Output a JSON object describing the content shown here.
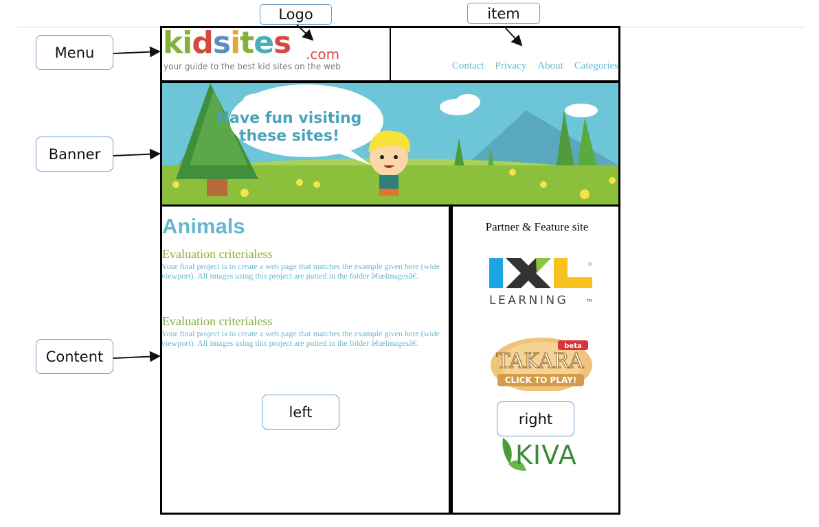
{
  "annotations": {
    "logo": "Logo",
    "item": "item",
    "menu": "Menu",
    "banner": "Banner",
    "content": "Content",
    "left": "left",
    "right": "right"
  },
  "logo": {
    "letters": [
      "k",
      "i",
      "d",
      "s",
      "i",
      "t",
      "e",
      "s"
    ],
    "domain_suffix": ".com",
    "tagline": "your guide to the best kid sites on the web"
  },
  "nav": {
    "items": [
      "Contact",
      "Privacy",
      "About",
      "Categories"
    ]
  },
  "banner": {
    "speech_line1": "Have fun visiting",
    "speech_line2": "these sites!"
  },
  "left": {
    "title": "Animals",
    "sections": [
      {
        "heading": "Evaluation criterialess",
        "body": "Your final project is to create a web page that matches the example given here (wide viewport). All images using this project are putted in the folder â€œImagesâ€."
      },
      {
        "heading": "Evaluation criterialess",
        "body": "Your final project is to create a web page that matches the example given here (wide viewport). All images using this project are putted in the folder â€œImagesâ€."
      }
    ]
  },
  "right": {
    "title": "Partner & Feature site",
    "partners": [
      {
        "name": "IXL LEARNING",
        "mark": "IXL",
        "sub": "LEARNING",
        "tm": "TM",
        "reg": "®"
      },
      {
        "name": "TAKARA",
        "badge": "beta",
        "cta": "CLICK TO PLAY!"
      },
      {
        "name": "KIVA",
        "mark": "KIVA"
      }
    ]
  },
  "colors": {
    "accent_blue": "#69b6cf",
    "accent_green": "#86b03c",
    "callout_border": "#6a9bc7"
  }
}
